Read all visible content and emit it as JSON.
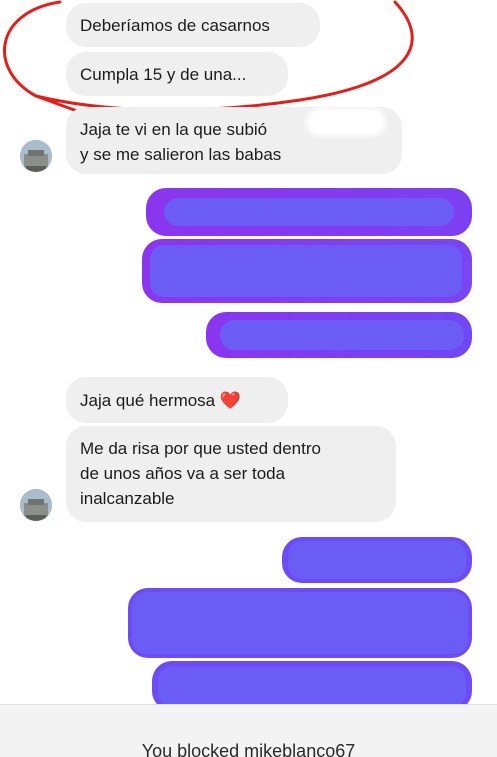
{
  "messages_in": [
    {
      "text": "Deberíamos de casarnos"
    },
    {
      "text": "Cumpla 15 y de una..."
    },
    {
      "line1": "Jaja te vi en la que subió",
      "line2": "y se me salieron las babas"
    },
    {
      "text": "Jaja qué hermosa",
      "emoji": "❤️"
    },
    {
      "line1": "Me da risa por que usted dentro",
      "line2": "de unos años va a ser toda",
      "line3": "inalcanzable"
    }
  ],
  "footer": {
    "blocked_text": "You blocked mikeblanco67"
  },
  "colors": {
    "incoming_bubble": "#efefef",
    "outgoing_gradient_start": "#8a35ee",
    "outgoing_gradient_end": "#6d4cf5",
    "redaction": "#6a5cf5",
    "annotation_circle": "#e0201c"
  },
  "icons": {
    "avatar": "profile-photo-building",
    "annotation": "red-circle-annotation",
    "redaction": "purple-scribble"
  }
}
